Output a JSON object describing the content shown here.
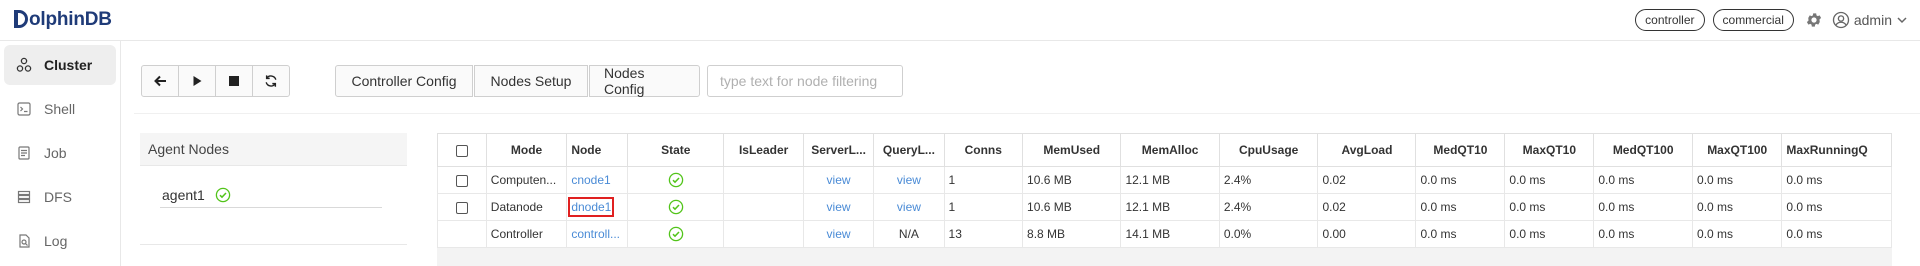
{
  "header": {
    "logo": "olphinDB",
    "badges": [
      "controller",
      "commercial"
    ],
    "user": "admin"
  },
  "sidebar": {
    "items": [
      {
        "label": "Cluster",
        "icon": "cluster-icon",
        "active": true
      },
      {
        "label": "Shell",
        "icon": "shell-icon",
        "active": false
      },
      {
        "label": "Job",
        "icon": "job-icon",
        "active": false
      },
      {
        "label": "DFS",
        "icon": "dfs-icon",
        "active": false
      },
      {
        "label": "Log",
        "icon": "log-icon",
        "active": false
      }
    ]
  },
  "toolbar": {
    "icon_buttons": [
      "back-arrow-icon",
      "play-icon",
      "stop-icon",
      "refresh-icon"
    ],
    "text_buttons": [
      "Controller Config",
      "Nodes Setup",
      "Nodes Config"
    ],
    "search_placeholder": "type text for node filtering"
  },
  "agent_panel": {
    "title": "Agent Nodes",
    "agents": [
      {
        "name": "agent1",
        "status": "ok"
      }
    ]
  },
  "nodes_table": {
    "columns": [
      "Mode",
      "Node",
      "State",
      "IsLeader",
      "ServerL...",
      "QueryL...",
      "Conns",
      "MemUsed",
      "MemAlloc",
      "CpuUsage",
      "AvgLoad",
      "MedQT10",
      "MaxQT10",
      "MedQT100",
      "MaxQT100",
      "MaxRunningQ"
    ],
    "rows": [
      {
        "mode": "Computen...",
        "node": "cnode1",
        "state": "ok",
        "isleader": "",
        "serverlog": "view",
        "querylog": "view",
        "conns": "1",
        "memused": "10.6 MB",
        "memalloc": "12.1 MB",
        "cpu": "2.4%",
        "avgload": "0.02",
        "medqt10": "0.0 ms",
        "maxqt10": "0.0 ms",
        "medqt100": "0.0 ms",
        "maxqt100": "0.0 ms",
        "maxrunning": "0.0 ms",
        "highlighted": false
      },
      {
        "mode": "Datanode",
        "node": "dnode1",
        "state": "ok",
        "isleader": "",
        "serverlog": "view",
        "querylog": "view",
        "conns": "1",
        "memused": "10.6 MB",
        "memalloc": "12.1 MB",
        "cpu": "2.4%",
        "avgload": "0.02",
        "medqt10": "0.0 ms",
        "maxqt10": "0.0 ms",
        "medqt100": "0.0 ms",
        "maxqt100": "0.0 ms",
        "maxrunning": "0.0 ms",
        "highlighted": true
      },
      {
        "mode": "Controller",
        "node": "controll...",
        "state": "ok",
        "isleader": "",
        "serverlog": "view",
        "querylog": "N/A",
        "conns": "13",
        "memused": "8.8 MB",
        "memalloc": "14.1 MB",
        "cpu": "0.0%",
        "avgload": "0.00",
        "medqt10": "0.0 ms",
        "maxqt10": "0.0 ms",
        "medqt100": "0.0 ms",
        "maxqt100": "0.0 ms",
        "maxrunning": "0.0 ms",
        "highlighted": false
      }
    ]
  },
  "colors": {
    "accent_link": "#4a8bd6",
    "ok_green": "#52c41a",
    "highlight_red": "#e02020",
    "logo_blue": "#1f3b78"
  }
}
